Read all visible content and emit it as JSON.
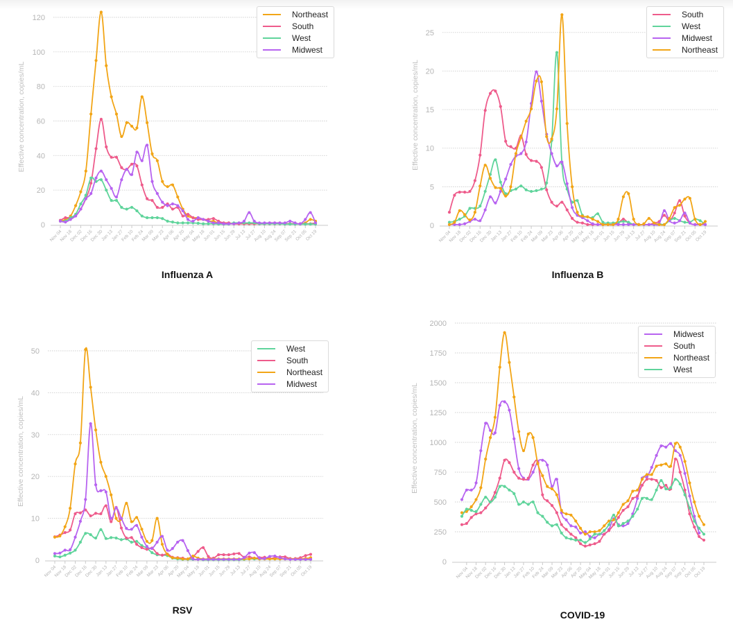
{
  "colors": {
    "Northeast": "#f2a516",
    "South": "#ee5b8b",
    "West": "#5fd49b",
    "Midwest": "#b763f0"
  },
  "chart_data": [
    {
      "id": "influenza-a",
      "type": "line",
      "title": "Influenza A",
      "xlabel": "",
      "ylabel": "Effective concentration, copies/mL",
      "ylim": [
        0,
        120
      ],
      "yticks": [
        0,
        20,
        40,
        60,
        80,
        100,
        120
      ],
      "grid": true,
      "legend_position": "top-right",
      "legend_order": [
        "Northeast",
        "South",
        "West",
        "Midwest"
      ],
      "x_start_week": "Nov 04",
      "x_tick_labels": [
        "Nov 04",
        "Nov 18",
        "Dec 02",
        "Dec 16",
        "Dec 30",
        "Jan 13",
        "Jan 27",
        "Feb 10",
        "Feb 24",
        "Mar 09",
        "Mar 23",
        "Apr 06",
        "Apr 20",
        "May 04",
        "May 18",
        "Jun 01",
        "Jun 15",
        "Jun 29",
        "Jul 13",
        "Jul 27",
        "Aug 10",
        "Aug 24",
        "Sep 07",
        "Sep 21",
        "Oct 05",
        "Oct 19"
      ],
      "series": [
        {
          "name": "Northeast",
          "values": [
            2,
            3,
            5,
            11,
            19,
            31,
            64,
            95,
            123,
            92,
            74,
            64,
            51,
            59,
            57,
            56,
            74,
            59,
            41,
            37,
            25,
            22,
            23,
            16,
            9,
            5,
            4,
            4,
            3,
            2,
            2,
            1,
            1,
            1,
            0.5,
            0.5,
            0.5,
            0.5,
            0.5,
            0.5,
            0.5,
            0.5,
            0.5,
            0.5,
            0.5,
            0.5,
            0.5,
            0.5,
            1,
            3,
            2
          ]
        },
        {
          "name": "South",
          "values": [
            2.5,
            4,
            4,
            5,
            9,
            15,
            24,
            44,
            61,
            45,
            39,
            39,
            33,
            32,
            35,
            34,
            23,
            15,
            14,
            10,
            10,
            12,
            9,
            10,
            5,
            6,
            4,
            3,
            3,
            3,
            3.5,
            2,
            1,
            1,
            0.5,
            0.5,
            0.5,
            0.5,
            0.5,
            0.5,
            0.5,
            1,
            1,
            1,
            0.5,
            0.5,
            0.5,
            0.5,
            0.5,
            0.5,
            1
          ]
        },
        {
          "name": "West",
          "values": [
            2,
            2,
            4,
            6,
            12,
            17,
            27,
            25,
            26,
            20,
            14,
            14,
            10,
            9,
            10,
            8,
            5,
            4,
            4,
            4,
            3.5,
            2,
            1.5,
            1,
            1,
            1,
            1,
            0.8,
            0.5,
            0.5,
            0.5,
            0.3,
            0.3,
            0.3,
            1,
            1,
            1,
            1,
            1,
            0.5,
            0.5,
            0.5,
            0.5,
            0.5,
            0.3,
            0.3,
            0.3,
            0.3,
            0.3,
            0.3,
            0.3
          ]
        },
        {
          "name": "Midwest",
          "values": [
            2,
            1.5,
            3,
            5,
            9,
            15,
            18,
            27,
            31,
            26,
            21,
            16,
            26,
            32,
            29,
            42,
            37,
            46,
            25,
            18,
            13,
            11,
            12,
            11,
            8,
            3,
            2,
            4,
            3,
            2,
            1,
            1,
            0.5,
            0.5,
            0.5,
            1,
            2,
            7,
            2,
            1,
            1,
            1,
            1,
            1,
            1,
            2,
            1,
            0.5,
            3,
            7,
            1
          ]
        }
      ]
    },
    {
      "id": "influenza-b",
      "type": "line",
      "title": "Influenza B",
      "xlabel": "",
      "ylabel": "Effective concentration, copies/mL",
      "ylim": [
        0,
        27.5
      ],
      "yticks": [
        0,
        5,
        10,
        15,
        20,
        25
      ],
      "grid": true,
      "legend_position": "top-right",
      "legend_order": [
        "South",
        "West",
        "Midwest",
        "Northeast"
      ],
      "x_start_week": "Nov 04",
      "x_tick_labels": [
        "Nov 04",
        "Nov 18",
        "Dec 02",
        "Dec 16",
        "Dec 30",
        "Jan 13",
        "Jan 27",
        "Feb 10",
        "Feb 24",
        "Mar 09",
        "Mar 23",
        "Apr 06",
        "Apr 20",
        "May 04",
        "May 18",
        "Jun 01",
        "Jun 15",
        "Jun 29",
        "Jul 13",
        "Jul 27",
        "Aug 10",
        "Aug 24",
        "Sep 07",
        "Sep 21",
        "Oct 05",
        "Oct 19"
      ],
      "series": [
        {
          "name": "South",
          "values": [
            1.7,
            3.9,
            4.3,
            4.3,
            4.4,
            5.8,
            9.1,
            14.9,
            17.1,
            17.4,
            15.4,
            10.9,
            10.2,
            10.0,
            11.6,
            9.2,
            8.4,
            8.3,
            7.5,
            4.6,
            3.0,
            2.5,
            3.0,
            2.0,
            0.9,
            0.4,
            0.3,
            0.1,
            0.1,
            0.1,
            0.1,
            0.1,
            0.1,
            0.3,
            0.8,
            0.3,
            0.1,
            0.1,
            0.1,
            0.1,
            0.3,
            0.5,
            1.3,
            0.6,
            1.6,
            3.2,
            1.2,
            0.3,
            0.1,
            0.1,
            0.1
          ]
        },
        {
          "name": "West",
          "values": [
            0.4,
            0.5,
            0.8,
            1.2,
            2.2,
            2.2,
            2.5,
            4.4,
            6.6,
            8.5,
            5.6,
            4.1,
            4.5,
            4.7,
            5.1,
            4.6,
            4.4,
            4.5,
            4.7,
            5.5,
            11.0,
            22.4,
            8.0,
            4.7,
            3.0,
            3.2,
            1.3,
            1.1,
            1.0,
            1.5,
            0.4,
            0.3,
            0.3,
            0.4,
            0.5,
            0.4,
            0.1,
            0.1,
            0.1,
            0.1,
            0.1,
            0.2,
            0.1,
            0.6,
            0.9,
            0.6,
            0.4,
            0.4,
            0.8,
            0.6,
            0.1
          ]
        },
        {
          "name": "Midwest",
          "values": [
            0.1,
            0.1,
            0.1,
            0.2,
            0.5,
            0.8,
            0.6,
            2.0,
            3.7,
            2.9,
            4.4,
            6.0,
            7.9,
            9.0,
            9.3,
            10.8,
            15.8,
            19.9,
            16.1,
            11.8,
            9.3,
            7.7,
            8.2,
            5.4,
            2.3,
            1.3,
            1.0,
            0.6,
            0.2,
            0.1,
            0.1,
            0.1,
            0.1,
            0.1,
            0.1,
            0.1,
            0.1,
            0.1,
            0.1,
            0.1,
            0.1,
            0.2,
            1.9,
            0.6,
            0.3,
            0.6,
            1.6,
            0.3,
            0.1,
            0.1,
            0.1
          ]
        },
        {
          "name": "Northeast",
          "values": [
            0.1,
            0.4,
            1.9,
            1.4,
            0.7,
            1.7,
            5.1,
            7.8,
            6.1,
            4.9,
            4.8,
            3.8,
            5.0,
            9.3,
            11.4,
            13.5,
            15.1,
            18.7,
            18.6,
            11.5,
            11.2,
            15.1,
            27.3,
            13.2,
            5.0,
            1.7,
            1.2,
            1.1,
            0.8,
            0.5,
            0.1,
            0.1,
            0.1,
            0.8,
            3.7,
            4.1,
            0.8,
            0.1,
            0.2,
            0.9,
            0.3,
            0.1,
            0.1,
            0.9,
            2.3,
            2.6,
            3.4,
            3.5,
            0.8,
            0.1,
            0.5
          ]
        }
      ]
    },
    {
      "id": "rsv",
      "type": "line",
      "title": "RSV",
      "xlabel": "",
      "ylabel": "Effective concentration, copies/mL",
      "ylim": [
        0,
        50
      ],
      "yticks": [
        0,
        10,
        20,
        30,
        40,
        50
      ],
      "grid": true,
      "legend_position": "top-right",
      "legend_order": [
        "West",
        "South",
        "Northeast",
        "Midwest"
      ],
      "x_start_week": "Nov 04",
      "x_tick_labels": [
        "Nov 04",
        "Nov 18",
        "Dec 02",
        "Dec 16",
        "Dec 30",
        "Jan 13",
        "Jan 27",
        "Feb 10",
        "Feb 24",
        "Mar 09",
        "Mar 23",
        "Apr 06",
        "Apr 20",
        "May 04",
        "May 18",
        "Jun 01",
        "Jun 15",
        "Jun 29",
        "Jul 13",
        "Jul 27",
        "Aug 10",
        "Aug 24",
        "Sep 07",
        "Sep 21",
        "Oct 05",
        "Oct 19"
      ],
      "series": [
        {
          "name": "West",
          "values": [
            1,
            0.8,
            1.2,
            1.7,
            2.4,
            4.3,
            6.4,
            6.1,
            5.3,
            7.3,
            5.2,
            5.4,
            5.3,
            4.9,
            5.1,
            4.3,
            4.5,
            3.5,
            2.9,
            1.8,
            1.3,
            1.2,
            1.1,
            0.5,
            0.3,
            0.2,
            0.2,
            0.2,
            0.2,
            0.1,
            0.1,
            0.1,
            0.1,
            0.1,
            0.1,
            0.1,
            0.1,
            0.2,
            0.3,
            0.3,
            0.3,
            0.3,
            0.3,
            0.3,
            0.3,
            0.3,
            0.3,
            0.2,
            0.2,
            0.2,
            0.2
          ]
        },
        {
          "name": "South",
          "values": [
            5.6,
            6.0,
            6.6,
            7.2,
            11.1,
            11.3,
            12.0,
            10.6,
            11.2,
            11.1,
            13.0,
            9.2,
            12.6,
            7.7,
            5.3,
            5.4,
            3.8,
            3.0,
            2.6,
            2.9,
            1.6,
            1.2,
            1.5,
            0.7,
            0.6,
            0.5,
            0.3,
            0.8,
            2.1,
            3.0,
            0.9,
            0.5,
            1.3,
            1.3,
            1.3,
            1.5,
            1.6,
            0.7,
            0.8,
            0.5,
            0.6,
            0.7,
            0.4,
            0.6,
            0.8,
            0.8,
            0.4,
            0.4,
            0.6,
            1.1,
            1.4
          ]
        },
        {
          "name": "Northeast",
          "values": [
            5.5,
            5.8,
            8.0,
            12.4,
            23.0,
            28.0,
            50.3,
            41.3,
            31.1,
            23.4,
            20.0,
            15.6,
            10.0,
            9.8,
            13.6,
            9.2,
            10.2,
            7.4,
            4.5,
            4.7,
            10.0,
            3.8,
            1.4,
            0.6,
            0.5,
            0.3,
            0.3,
            1.0,
            0.5,
            0.3,
            0.3,
            0.3,
            0.3,
            0.3,
            0.3,
            0.3,
            0.3,
            0.3,
            0.3,
            0.5,
            0.3,
            0.3,
            0.3,
            0.3,
            0.3,
            0.3,
            0.3,
            0.3,
            0.3,
            0.4,
            0.6
          ]
        },
        {
          "name": "Midwest",
          "values": [
            1.6,
            1.7,
            2.4,
            2.5,
            5.5,
            9.3,
            14.5,
            32.6,
            18.0,
            16.6,
            16.3,
            10.0,
            12.5,
            10.0,
            7.6,
            7.4,
            8.3,
            5.5,
            3.3,
            2.8,
            4.3,
            5.7,
            2.4,
            2.8,
            4.3,
            4.7,
            2.3,
            0.3,
            0.2,
            0.2,
            0.2,
            0.2,
            0.2,
            0.2,
            0.2,
            0.2,
            0.2,
            0.6,
            1.7,
            1.8,
            0.5,
            0.4,
            0.9,
            1.0,
            0.6,
            0.3,
            0.2,
            0.2,
            0.2,
            0.2,
            0.2
          ]
        }
      ]
    },
    {
      "id": "covid-19",
      "type": "line",
      "title": "COVID-19",
      "xlabel": "",
      "ylabel": "Effective concentration, copies/mL",
      "ylim": [
        0,
        2000
      ],
      "yticks": [
        0,
        250,
        500,
        750,
        1000,
        1250,
        1500,
        1750,
        2000
      ],
      "grid": true,
      "legend_position": "top-right",
      "legend_order": [
        "Midwest",
        "South",
        "Northeast",
        "West"
      ],
      "x_start_week": "Oct 28",
      "x_tick_labels": [
        "Nov 04",
        "Nov 18",
        "Dec 02",
        "Dec 16",
        "Dec 30",
        "Jan 13",
        "Jan 27",
        "Feb 10",
        "Feb 24",
        "Mar 09",
        "Mar 23",
        "Apr 06",
        "Apr 20",
        "May 04",
        "May 18",
        "Jun 01",
        "Jun 15",
        "Jun 29",
        "Jul 13",
        "Jul 27",
        "Aug 10",
        "Aug 24",
        "Sep 07",
        "Sep 21",
        "Oct 05",
        "Oct 19"
      ],
      "series": [
        {
          "name": "Midwest",
          "values": [
            520,
            600,
            600,
            660,
            930,
            1160,
            1100,
            1080,
            1310,
            1340,
            1270,
            1030,
            780,
            700,
            690,
            750,
            840,
            850,
            810,
            630,
            690,
            410,
            350,
            300,
            290,
            240,
            250,
            210,
            200,
            230,
            230,
            270,
            360,
            310,
            300,
            320,
            400,
            530,
            700,
            710,
            790,
            890,
            970,
            960,
            990,
            930,
            890,
            740,
            550,
            380,
            240
          ]
        },
        {
          "name": "South",
          "values": [
            310,
            320,
            370,
            400,
            410,
            450,
            500,
            580,
            700,
            850,
            830,
            750,
            700,
            690,
            700,
            810,
            830,
            560,
            510,
            470,
            410,
            310,
            270,
            230,
            200,
            150,
            130,
            140,
            150,
            170,
            230,
            260,
            310,
            370,
            430,
            460,
            530,
            550,
            640,
            690,
            690,
            680,
            620,
            640,
            610,
            860,
            750,
            600,
            400,
            290,
            210,
            180
          ]
        },
        {
          "name": "Northeast",
          "values": [
            410,
            420,
            460,
            520,
            620,
            860,
            1040,
            1210,
            1630,
            1920,
            1670,
            1380,
            1090,
            930,
            1070,
            1040,
            820,
            720,
            630,
            610,
            560,
            430,
            400,
            390,
            340,
            280,
            230,
            250,
            250,
            260,
            300,
            340,
            350,
            410,
            480,
            510,
            590,
            600,
            690,
            730,
            730,
            800,
            810,
            820,
            800,
            990,
            960,
            840,
            660,
            500,
            380,
            310
          ]
        },
        {
          "name": "West",
          "values": [
            380,
            440,
            430,
            420,
            480,
            540,
            500,
            540,
            630,
            630,
            600,
            570,
            480,
            500,
            480,
            500,
            410,
            380,
            330,
            300,
            310,
            240,
            200,
            190,
            180,
            180,
            160,
            190,
            230,
            230,
            260,
            310,
            390,
            300,
            320,
            340,
            380,
            440,
            530,
            530,
            520,
            600,
            680,
            610,
            620,
            690,
            650,
            560,
            450,
            340,
            280,
            230
          ]
        }
      ]
    }
  ]
}
